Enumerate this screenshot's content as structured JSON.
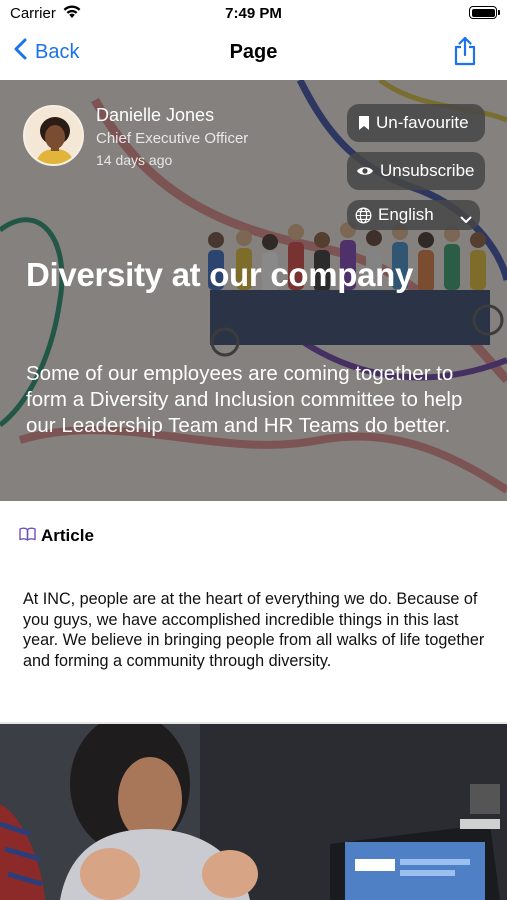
{
  "status_bar": {
    "carrier": "Carrier",
    "time": "7:49 PM"
  },
  "nav": {
    "back_label": "Back",
    "title": "Page"
  },
  "author": {
    "name": "Danielle Jones",
    "role": "Chief Executive Officer",
    "posted": "14 days ago"
  },
  "actions": {
    "favourite_label": "Un-favourite",
    "subscribe_label": "Unsubscribe",
    "language_selected": "English"
  },
  "hero": {
    "title": "Diversity at our company",
    "description": "Some of our employees are coming together to form a Diversity and Inclusion committee to help our Leadership Team and HR Teams do better."
  },
  "article": {
    "type_label": "Article",
    "body": "At INC, people are at the heart of everything we do. Because of you guys, we have accomplished incredible things in this last year. We believe in bringing people from all walks of life together and forming a community through diversity."
  },
  "colors": {
    "accent": "#1a73e8",
    "article_icon": "#6b4fbb"
  },
  "icons": [
    "wifi-icon",
    "battery-icon",
    "back-chevron-icon",
    "share-icon",
    "bookmark-icon",
    "eye-icon",
    "globe-icon",
    "chevron-down-icon",
    "book-icon"
  ]
}
